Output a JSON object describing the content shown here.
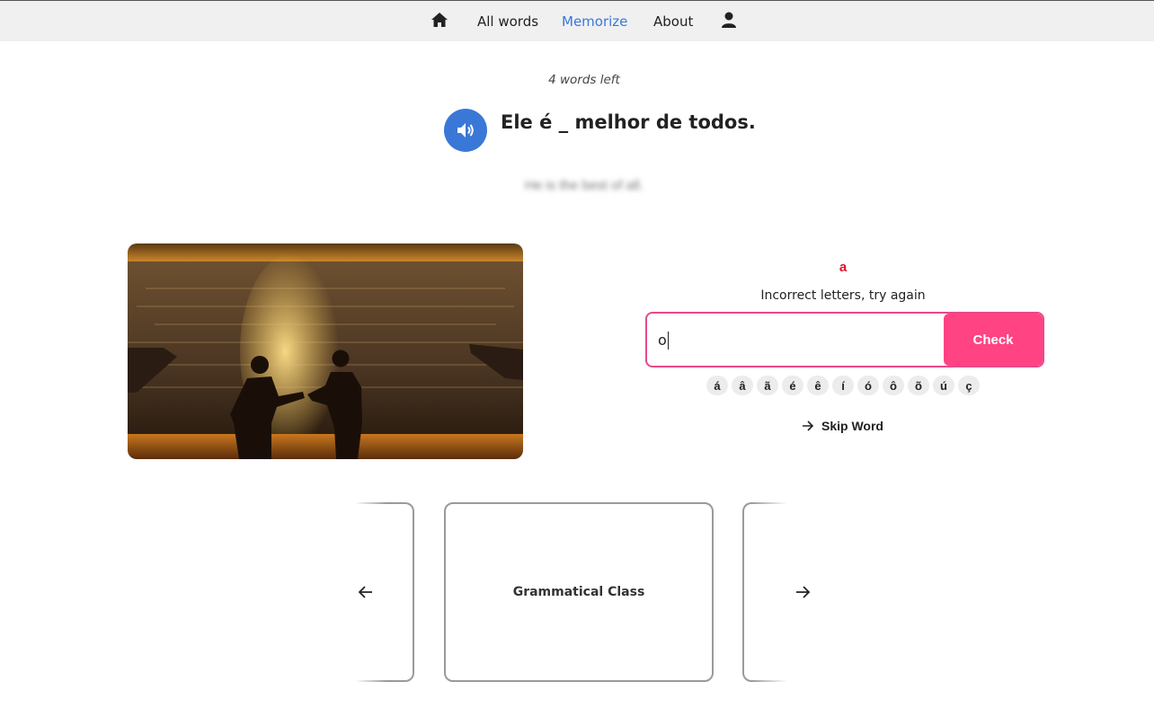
{
  "nav": {
    "home_icon": "home-icon",
    "items": [
      {
        "label": "All words",
        "active": false
      },
      {
        "label": "Memorize",
        "active": true
      },
      {
        "label": "About",
        "active": false
      }
    ],
    "user_icon": "user-icon",
    "accent_color": "#3a78d8"
  },
  "exercise": {
    "words_left": "4 words left",
    "sentence": "Ele é _ melhor de todos.",
    "translation": "He is the best of all.",
    "audio_icon": "speaker-icon"
  },
  "answer": {
    "hint_letter": "a",
    "feedback": "Incorrect letters, try again",
    "input_value": "o",
    "check_label": "Check",
    "check_color": "#ff4383",
    "accents": [
      "á",
      "â",
      "ã",
      "é",
      "ê",
      "í",
      "ó",
      "ô",
      "õ",
      "ú",
      "ç"
    ],
    "skip_label": "Skip Word"
  },
  "carousel": {
    "center_title": "Grammatical Class",
    "prev_icon": "arrow-left-icon",
    "next_icon": "arrow-right-icon"
  }
}
